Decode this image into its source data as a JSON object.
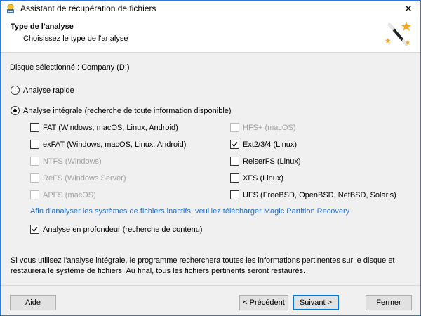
{
  "window": {
    "title": "Assistant de récupération de fichiers",
    "close_glyph": "✕"
  },
  "header": {
    "title": "Type de l'analyse",
    "subtitle": "Choisissez le type de l'analyse"
  },
  "disk": {
    "label": "Disque sélectionné : Company (D:)"
  },
  "scan_modes": [
    {
      "label": "Analyse rapide",
      "checked": false
    },
    {
      "label": "Analyse intégrale (recherche de toute information disponible)",
      "checked": true
    }
  ],
  "filesystems_left": [
    {
      "label": "FAT (Windows, macOS, Linux, Android)",
      "checked": false,
      "enabled": true
    },
    {
      "label": "exFAT (Windows, macOS, Linux, Android)",
      "checked": false,
      "enabled": true
    },
    {
      "label": "NTFS (Windows)",
      "checked": false,
      "enabled": false
    },
    {
      "label": "ReFS (Windows Server)",
      "checked": false,
      "enabled": false
    },
    {
      "label": "APFS (macOS)",
      "checked": false,
      "enabled": false
    }
  ],
  "filesystems_right": [
    {
      "label": "HFS+ (macOS)",
      "checked": false,
      "enabled": false
    },
    {
      "label": "Ext2/3/4 (Linux)",
      "checked": true,
      "enabled": true
    },
    {
      "label": "ReiserFS (Linux)",
      "checked": false,
      "enabled": true
    },
    {
      "label": "XFS (Linux)",
      "checked": false,
      "enabled": true
    },
    {
      "label": "UFS (FreeBSD, OpenBSD, NetBSD, Solaris)",
      "checked": false,
      "enabled": true
    }
  ],
  "partition_link": "Afin d'analyser les systèmes de fichiers inactifs, veuillez télécharger Magic Partition Recovery",
  "deep_scan": {
    "label": "Analyse en profondeur (recherche de contenu)",
    "checked": true
  },
  "info_text": "Si vous utilisez l'analyse intégrale, le programme recherchera toutes les informations pertinentes sur le disque et restaurera le système de fichiers. Au final, tous les fichiers pertinents seront restaurés.",
  "buttons": {
    "help": "Aide",
    "previous": "< Précédent",
    "next": "Suivant >",
    "close": "Fermer"
  },
  "colors": {
    "link": "#1f6fd1",
    "window_border": "#2b7bd4",
    "default_button_border": "#0078d7"
  }
}
